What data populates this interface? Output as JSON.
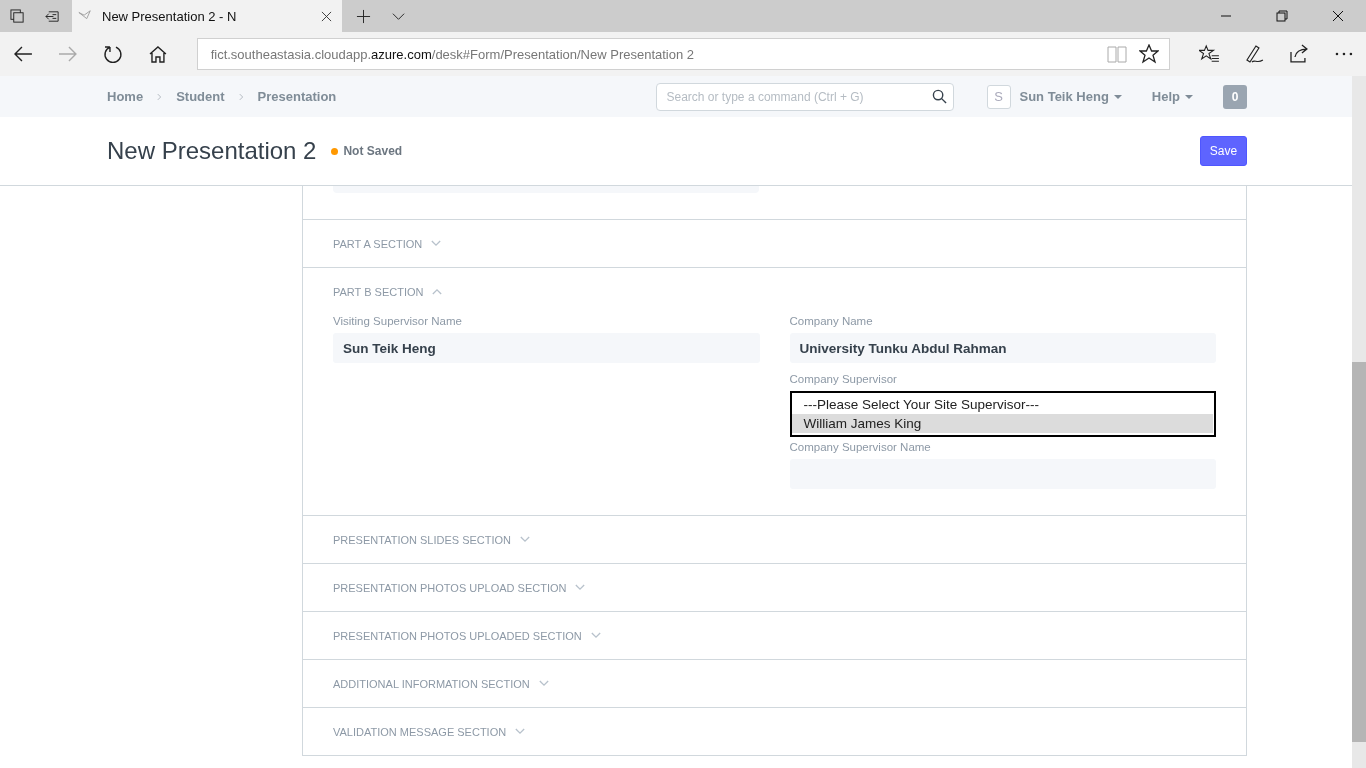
{
  "browser": {
    "tab_title": "New Presentation 2 - N",
    "address": {
      "prefix": "fict.southeastasia.cloudapp.",
      "domain": "azure.com",
      "path": "/desk#Form/Presentation/New Presentation 2"
    }
  },
  "navbar": {
    "breadcrumbs": [
      "Home",
      "Student",
      "Presentation"
    ],
    "search": {
      "placeholder": "Search or type a command (Ctrl + G)"
    },
    "user": {
      "initial": "S",
      "name": "Sun Teik Heng"
    },
    "help": "Help",
    "notifications": "0"
  },
  "page": {
    "title": "New Presentation 2",
    "status": "Not Saved",
    "save": "Save"
  },
  "sections": [
    {
      "title": "PART A SECTION",
      "expanded": false
    },
    {
      "title": "PART B SECTION",
      "expanded": true,
      "left": [
        {
          "label": "Visiting Supervisor Name",
          "value": "Sun Teik Heng"
        }
      ],
      "right": [
        {
          "label": "Company Name",
          "value": "University Tunku Abdul Rahman"
        },
        {
          "label": "Company Supervisor",
          "kind": "select",
          "options": [
            {
              "text": "---Please Select Your Site Supervisor---",
              "selected": false
            },
            {
              "text": "William James King",
              "selected": true
            }
          ]
        },
        {
          "label": "Company Supervisor Name"
        }
      ]
    },
    {
      "title": "PRESENTATION SLIDES SECTION",
      "expanded": false
    },
    {
      "title": "PRESENTATION PHOTOS UPLOAD SECTION",
      "expanded": false
    },
    {
      "title": "PRESENTATION PHOTOS UPLOADED SECTION",
      "expanded": false
    },
    {
      "title": "ADDITIONAL INFORMATION SECTION",
      "expanded": false
    },
    {
      "title": "VALIDATION MESSAGE SECTION",
      "expanded": false
    }
  ]
}
